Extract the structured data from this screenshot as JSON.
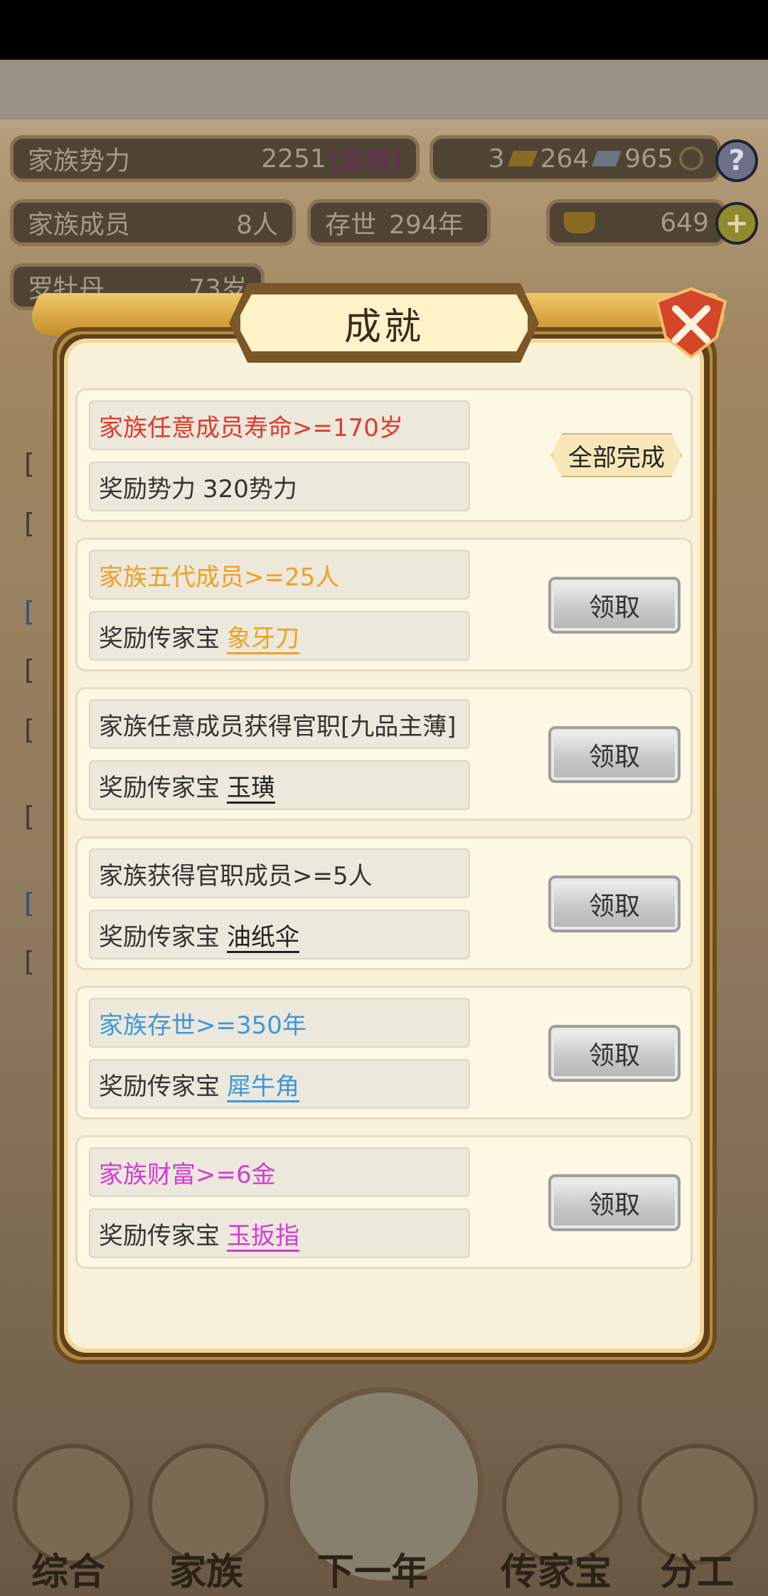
{
  "background": {
    "stats": {
      "power_label": "家族势力",
      "power_value": "2251",
      "power_rank": "[龙族]",
      "currency_a": "3",
      "currency_b": "264",
      "currency_c": "965",
      "members_label": "家族成员",
      "members_value": "8人",
      "existence_label": "存世",
      "existence_value": "294年",
      "gold": "649",
      "head_name": "罗牡丹",
      "head_age": "73岁"
    },
    "bottom_nav": [
      "综合",
      "家族",
      "下一年",
      "传家宝",
      "分工"
    ]
  },
  "dialog": {
    "title": "成就",
    "colors": {
      "red": "#e03a2a",
      "orange": "#f0a020",
      "dark": "#333333",
      "blue": "#3c98db",
      "magenta": "#d53ad8"
    },
    "achievements": [
      {
        "condition": "家族任意成员寿命>=170岁",
        "color": "red",
        "reward_prefix": "奖励势力",
        "reward_item": "320势力",
        "status": "全部完成",
        "completed": true
      },
      {
        "condition": "家族五代成员>=25人",
        "color": "orange",
        "reward_prefix": "奖励传家宝",
        "reward_item": "象牙刀",
        "status": "领取",
        "completed": false
      },
      {
        "condition": "家族任意成员获得官职[九品主薄]",
        "color": "dark",
        "reward_prefix": "奖励传家宝",
        "reward_item": "玉璜",
        "status": "领取",
        "completed": false
      },
      {
        "condition": "家族获得官职成员>=5人",
        "color": "dark",
        "reward_prefix": "奖励传家宝",
        "reward_item": "油纸伞",
        "status": "领取",
        "completed": false
      },
      {
        "condition": "家族存世>=350年",
        "color": "blue",
        "reward_prefix": "奖励传家宝",
        "reward_item": "犀牛角",
        "status": "领取",
        "completed": false
      },
      {
        "condition": "家族财富>=6金",
        "color": "magenta",
        "reward_prefix": "奖励传家宝",
        "reward_item": "玉扳指",
        "status": "领取",
        "completed": false
      }
    ]
  }
}
